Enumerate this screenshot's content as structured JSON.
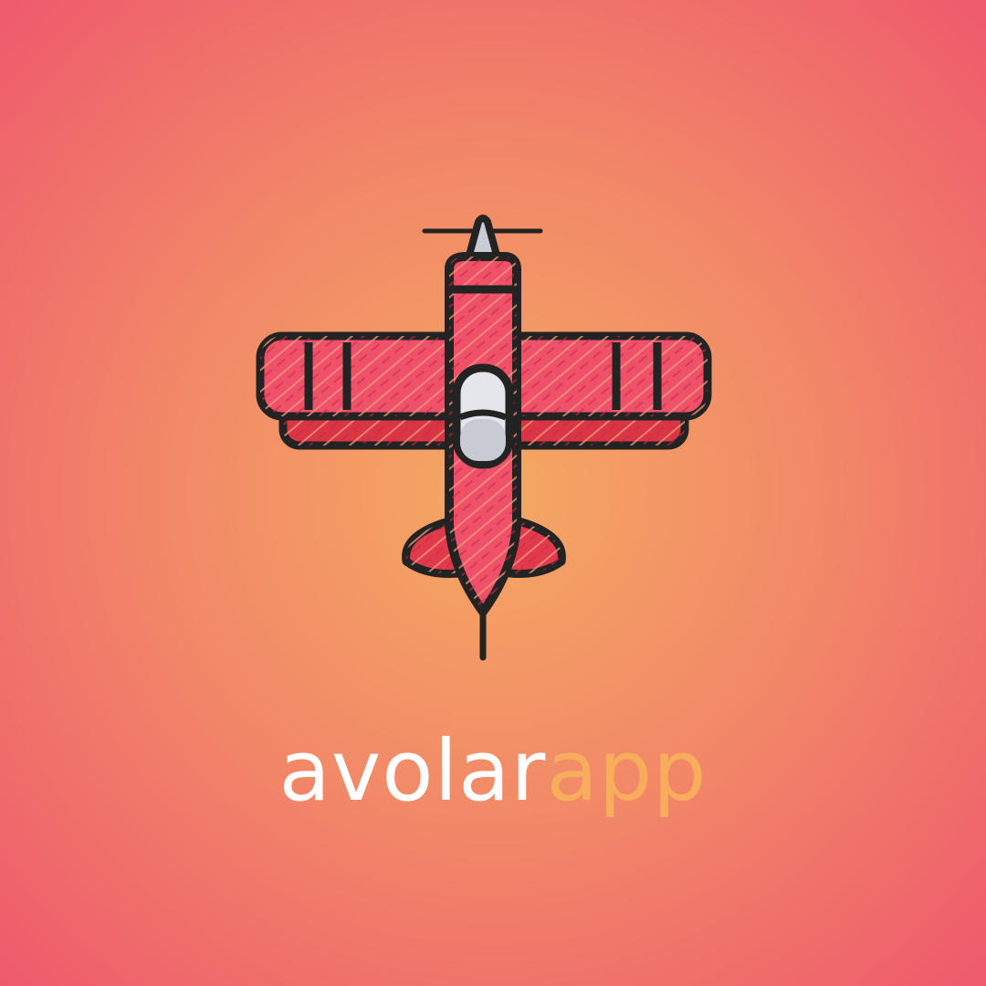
{
  "brand": {
    "name_part_1": "avolar",
    "name_part_2": "app",
    "logo_icon": "biplane-icon"
  },
  "colors": {
    "background_center": "#f5a862",
    "background_edge": "#ee5a6c",
    "wordmark_primary": "#ffffff",
    "wordmark_accent": "#f7ad5b",
    "plane_body": "#f0516a",
    "plane_shadow": "#d93545",
    "cockpit": "#e4e6ec",
    "outline": "#232323"
  }
}
